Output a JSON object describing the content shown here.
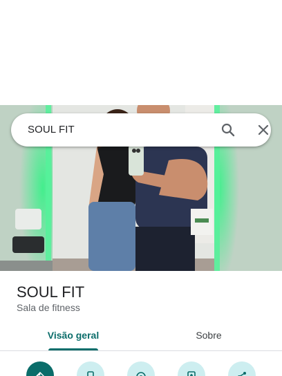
{
  "search": {
    "query": "SOUL FIT",
    "search_icon": "search-icon",
    "close_icon": "close-icon"
  },
  "place": {
    "name": "SOUL FIT",
    "category": "Sala de fitness"
  },
  "tabs": [
    {
      "label": "Visão geral",
      "selected": true
    },
    {
      "label": "Sobre",
      "selected": false
    }
  ],
  "actions": [
    {
      "icon": "directions-icon",
      "primary": true
    },
    {
      "icon": "phone-icon"
    },
    {
      "icon": "location-icon"
    },
    {
      "icon": "save-icon"
    },
    {
      "icon": "share-icon"
    }
  ],
  "colors": {
    "accent": "#0b6d6a",
    "action_bg": "#cdeef0",
    "neon": "#35e27a"
  }
}
